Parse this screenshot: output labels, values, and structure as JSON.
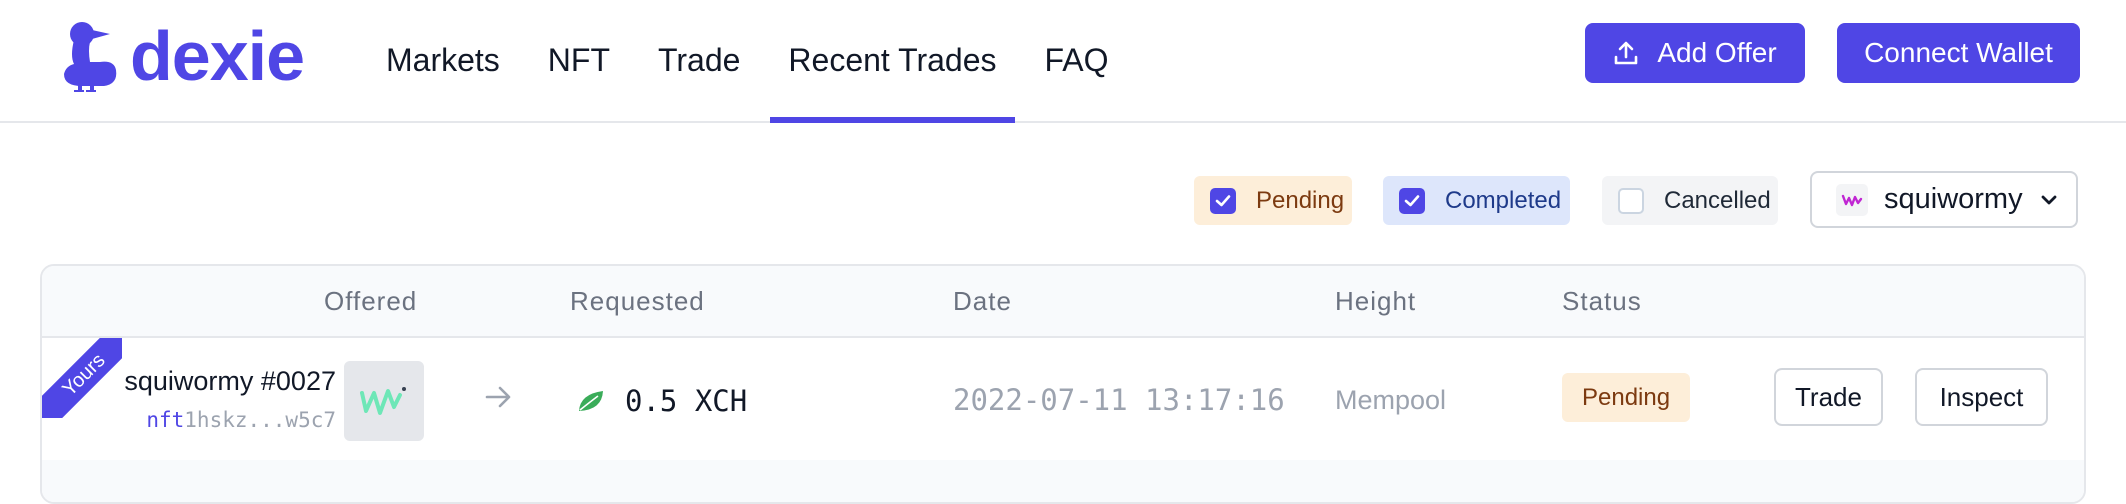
{
  "brand": {
    "name": "dexie",
    "accent": "#4f46e5"
  },
  "nav": {
    "items": [
      {
        "label": "Markets"
      },
      {
        "label": "NFT"
      },
      {
        "label": "Trade"
      },
      {
        "label": "Recent Trades",
        "active": true
      },
      {
        "label": "FAQ"
      }
    ]
  },
  "header": {
    "add_offer_label": "Add Offer",
    "connect_wallet_label": "Connect Wallet"
  },
  "filters": {
    "pending": {
      "label": "Pending",
      "checked": true
    },
    "completed": {
      "label": "Completed",
      "checked": true
    },
    "cancelled": {
      "label": "Cancelled",
      "checked": false
    },
    "collection_select": {
      "value": "squiwormy"
    }
  },
  "table": {
    "headers": {
      "offered": "Offered",
      "requested": "Requested",
      "date": "Date",
      "height": "Height",
      "status": "Status"
    },
    "rows": [
      {
        "ribbon": "Yours",
        "offered_name": "squiwormy #0027",
        "offered_id_prefix": "nft",
        "offered_id_rest": "1hskz...w5c7",
        "requested": "0.5 XCH",
        "date": "2022-07-11 13:17:16",
        "height": "Mempool",
        "status": "Pending",
        "trade_label": "Trade",
        "inspect_label": "Inspect"
      }
    ]
  }
}
